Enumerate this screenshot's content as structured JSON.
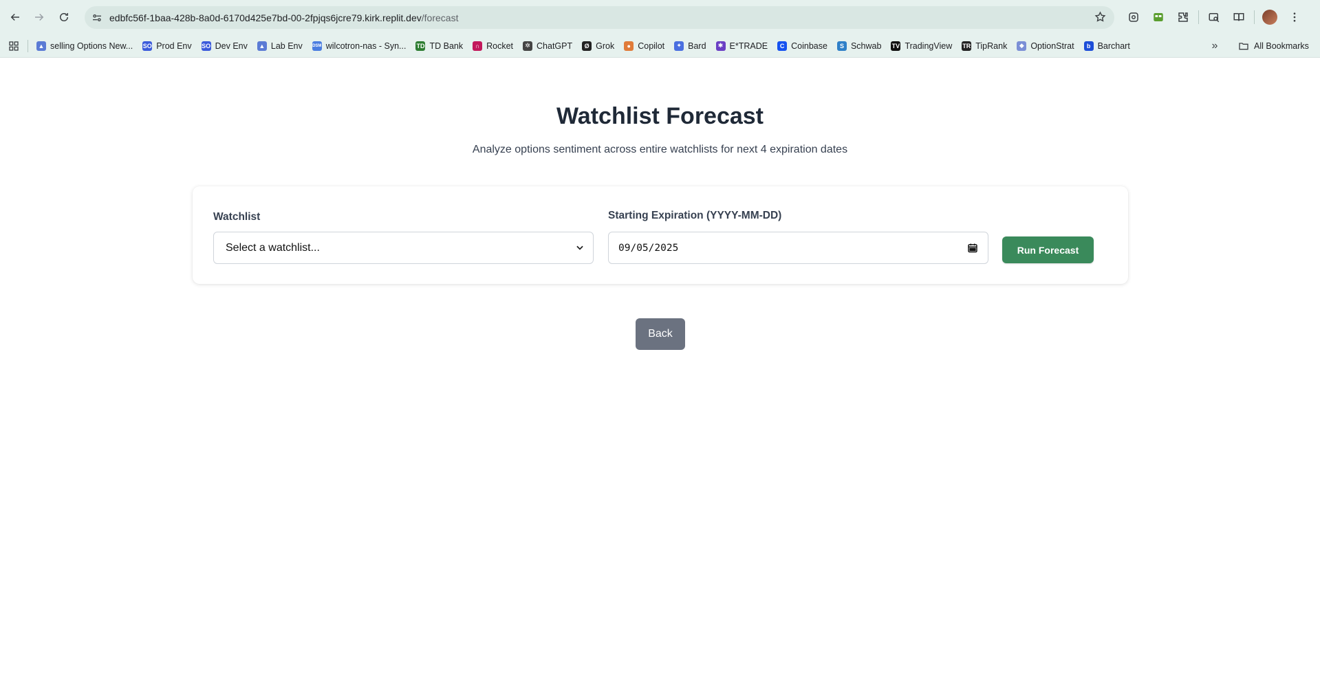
{
  "browser": {
    "url_host": "edbfc56f-1baa-428b-8a0d-6170d425e7bd-00-2fpjqs6jcre79.kirk.replit.dev",
    "url_path": "/forecast",
    "bookmarks": [
      {
        "label": "selling Options New...",
        "icon": "chart-favicon",
        "color": "#5b7bd5",
        "glyph": "▲"
      },
      {
        "label": "Prod Env",
        "icon": "so-favicon",
        "color": "#3b5bdb",
        "glyph": "SO"
      },
      {
        "label": "Dev Env",
        "icon": "so-favicon",
        "color": "#3b5bdb",
        "glyph": "SO"
      },
      {
        "label": "Lab Env",
        "icon": "chart-favicon",
        "color": "#5b7bd5",
        "glyph": "▲"
      },
      {
        "label": "wilcotron-nas - Syn...",
        "icon": "dsm-favicon",
        "color": "#4a7de0",
        "glyph": "DSM"
      },
      {
        "label": "TD Bank",
        "icon": "td-favicon",
        "color": "#2e7d32",
        "glyph": "TD"
      },
      {
        "label": "Rocket",
        "icon": "rocket-favicon",
        "color": "#c2185b",
        "glyph": "∩"
      },
      {
        "label": "ChatGPT",
        "icon": "chatgpt-favicon",
        "color": "#444444",
        "glyph": "✲"
      },
      {
        "label": "Grok",
        "icon": "grok-favicon",
        "color": "#222222",
        "glyph": "Ø"
      },
      {
        "label": "Copilot",
        "icon": "copilot-favicon",
        "color": "#e07b39",
        "glyph": "●"
      },
      {
        "label": "Bard",
        "icon": "bard-favicon",
        "color": "#4a6fe0",
        "glyph": "✦"
      },
      {
        "label": "E*TRADE",
        "icon": "etrade-favicon",
        "color": "#6a3fc4",
        "glyph": "✱"
      },
      {
        "label": "Coinbase",
        "icon": "coinbase-favicon",
        "color": "#1652f0",
        "glyph": "C"
      },
      {
        "label": "Schwab",
        "icon": "schwab-favicon",
        "color": "#2f80c8",
        "glyph": "S"
      },
      {
        "label": "TradingView",
        "icon": "tradingview-favicon",
        "color": "#111111",
        "glyph": "TV"
      },
      {
        "label": "TipRank",
        "icon": "tipranks-favicon",
        "color": "#222222",
        "glyph": "TR"
      },
      {
        "label": "OptionStrat",
        "icon": "optionstrat-favicon",
        "color": "#7b8fd6",
        "glyph": "◆"
      },
      {
        "label": "Barchart",
        "icon": "barchart-favicon",
        "color": "#1d4ed8",
        "glyph": "b"
      }
    ],
    "all_bookmarks_label": "All Bookmarks"
  },
  "page": {
    "title": "Watchlist Forecast",
    "subtitle": "Analyze options sentiment across entire watchlists for next 4 expiration dates"
  },
  "form": {
    "watchlist_label": "Watchlist",
    "watchlist_selected": "Select a watchlist...",
    "expiration_label": "Starting Expiration (YYYY-MM-DD)",
    "expiration_value": "09/05/2025",
    "run_button": "Run Forecast"
  },
  "back_button": "Back",
  "colors": {
    "run_button": "#3a8a5b",
    "back_button": "#6b7280",
    "title": "#1f2937",
    "chrome": "#e6f1ee"
  }
}
